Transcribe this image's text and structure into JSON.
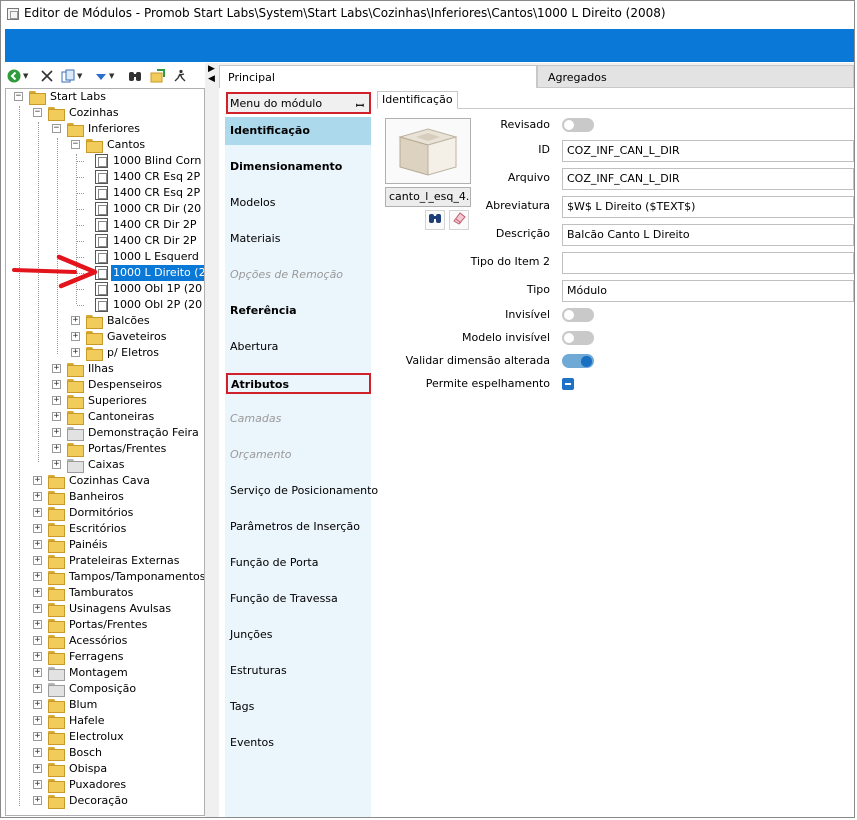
{
  "window": {
    "title": "Editor de Módulos - Promob Start Labs\\System\\Start Labs\\Cozinhas\\Inferiores\\Cantos\\1000 L Direito (2008)",
    "accent_color": "#0a78d6",
    "highlight_color": "#d0202a"
  },
  "toolbar": {
    "icons": [
      "back-icon",
      "close-icon",
      "copy-icon",
      "down-arrow-icon",
      "binoculars-icon",
      "export-icon",
      "run-icon"
    ]
  },
  "tree": {
    "root": "Start Labs",
    "cozinhas": "Cozinhas",
    "inferiores": "Inferiores",
    "cantos": "Cantos",
    "cantos_items": [
      "1000 Blind Corn",
      "1400 CR Esq 2P",
      "1400 CR Esq 2P",
      "1000 CR Dir (20",
      "1400 CR Dir 2P",
      "1400 CR Dir 2P",
      "1000 L Esquerd",
      "1000 L Direito (2",
      "1000 Obl 1P (20",
      "1000 Obl 2P (20"
    ],
    "selected_index": 7,
    "inferiores_siblings": [
      "Balcões",
      "Gaveteiros",
      "p/ Eletros"
    ],
    "cozinhas_children": [
      "Ilhas",
      "Despenseiros",
      "Superiores",
      "Cantoneiras",
      "Demonstração Feira",
      "Portas/Frentes",
      "Caixas"
    ],
    "top_level": [
      "Cozinhas Cava",
      "Banheiros",
      "Dormitórios",
      "Escritórios",
      "Painéis",
      "Prateleiras Externas",
      "Tampos/Tamponamentos",
      "Tamburatos",
      "Usinagens Avulsas",
      "Portas/Frentes",
      "Acessórios",
      "Ferragens",
      "Montagem",
      "Composição",
      "Blum",
      "Hafele",
      "Electrolux",
      "Bosch",
      "Obispa",
      "Puxadores",
      "Decoração"
    ]
  },
  "tabs": {
    "principal": "Principal",
    "agregados": "Agregados"
  },
  "menu": {
    "header": "Menu do módulo",
    "items": [
      "Identificação",
      "Dimensionamento",
      "Modelos",
      "Materiais",
      "Opções de Remoção",
      "Referência",
      "Abertura",
      "Atributos",
      "Camadas",
      "Orçamento",
      "Serviço de Posicionamento",
      "Parâmetros de Inserção",
      "Função de Porta",
      "Função de Travessa",
      "Junções",
      "Estruturas",
      "Tags",
      "Eventos"
    ]
  },
  "identificacao": {
    "tab_label": "Identificação",
    "image_name": "canto_l_esq_4.",
    "fields": {
      "revisado_label": "Revisado",
      "id_label": "ID",
      "id_value": "COZ_INF_CAN_L_DIR",
      "arquivo_label": "Arquivo",
      "arquivo_value": "COZ_INF_CAN_L_DIR",
      "abreviatura_label": "Abreviatura",
      "abreviatura_value": "$W$ L Direito ($TEXT$)",
      "descricao_label": "Descrição",
      "descricao_value": "Balcão Canto L Direito",
      "tipo_item2_label": "Tipo do Item 2",
      "tipo_item2_value": "",
      "tipo_label": "Tipo",
      "tipo_value": "Módulo",
      "invisivel_label": "Invisível",
      "modelo_invisivel_label": "Modelo invisível",
      "validar_label": "Validar dimensão alterada",
      "espelhamento_label": "Permite espelhamento"
    },
    "toggles": {
      "revisado": false,
      "invisivel": false,
      "modelo_invisivel": false,
      "validar_dimensao": true,
      "permite_espelhamento": "indeterminate"
    }
  }
}
